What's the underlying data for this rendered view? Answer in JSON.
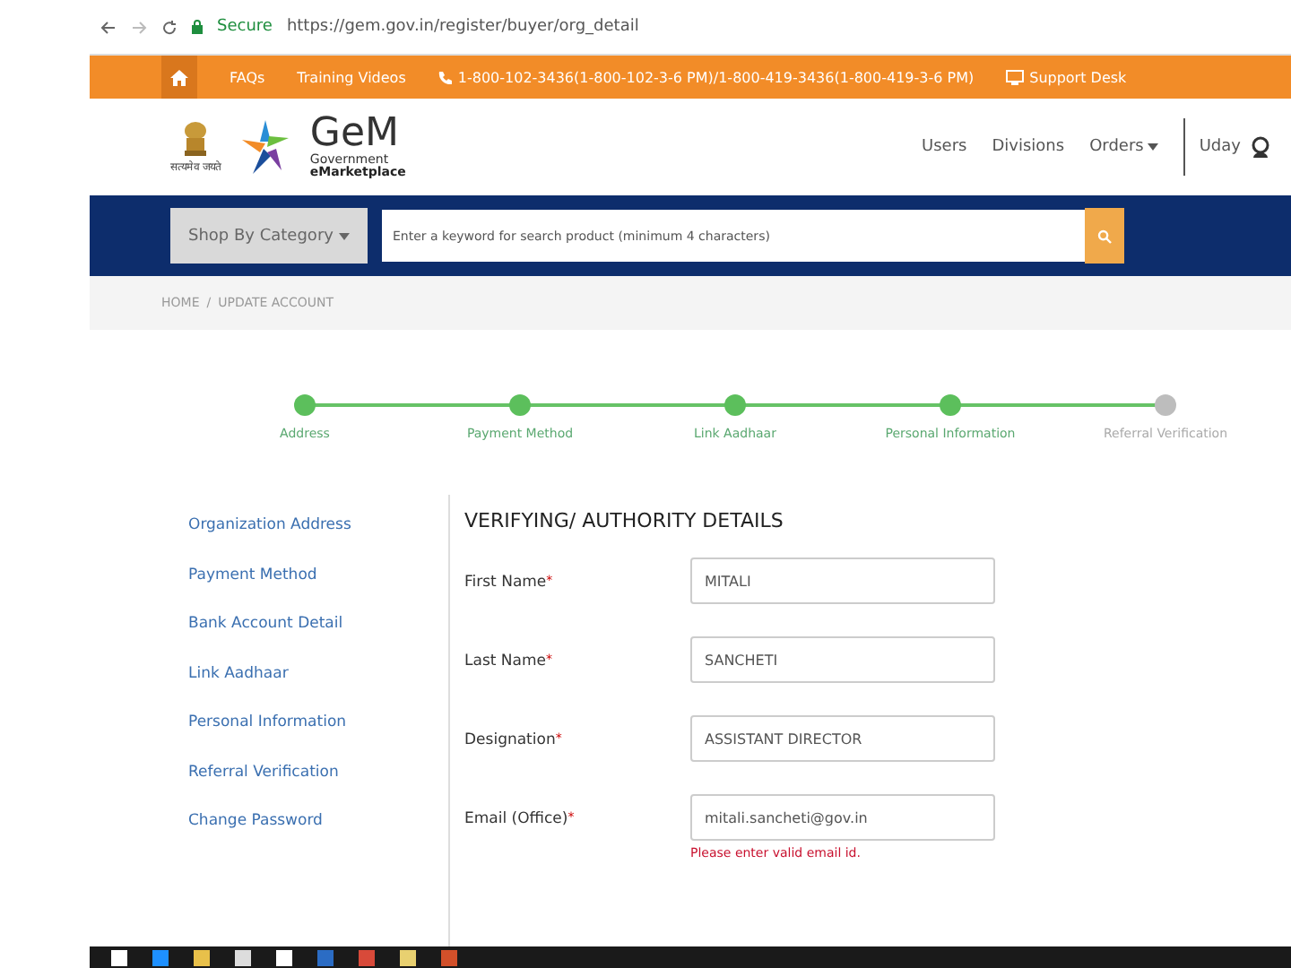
{
  "browser": {
    "secure_label": "Secure",
    "url": "https://gem.gov.in/register/buyer/org_detail"
  },
  "top_bar": {
    "links": [
      {
        "kind": "home"
      },
      {
        "kind": "text",
        "label": "FAQs"
      },
      {
        "kind": "text",
        "label": "Training Videos"
      },
      {
        "kind": "phone",
        "label": "1-800-102-3436(1-800-102-3-6 PM)/1-800-419-3436(1-800-419-3-6 PM)"
      },
      {
        "kind": "desk",
        "label": "Support Desk"
      }
    ]
  },
  "header": {
    "emblem_caption": "सत्यमेव जयते",
    "logo": {
      "name": "GeM",
      "line1": "Government",
      "line2": "eMarketplace"
    },
    "nav": [
      {
        "label": "Users",
        "dropdown": false
      },
      {
        "label": "Divisions",
        "dropdown": false
      },
      {
        "label": "Orders",
        "dropdown": true
      }
    ],
    "user": "Uday"
  },
  "search_bar": {
    "category_button": "Shop By Category",
    "placeholder": "Enter a keyword for search product (minimum 4 characters)"
  },
  "breadcrumb": {
    "items": [
      "HOME",
      "UPDATE ACCOUNT"
    ],
    "separator": "/"
  },
  "steps": [
    {
      "label": "Address",
      "done": true
    },
    {
      "label": "Payment Method",
      "done": true
    },
    {
      "label": "Link Aadhaar",
      "done": true
    },
    {
      "label": "Personal Information",
      "done": true
    },
    {
      "label": "Referral Verification",
      "done": false
    }
  ],
  "sidebar": {
    "items": [
      "Organization Address",
      "Payment Method",
      "Bank Account Detail",
      "Link Aadhaar",
      "Personal Information",
      "Referral Verification",
      "Change Password"
    ]
  },
  "form": {
    "title": "VERIFYING/ AUTHORITY DETAILS",
    "fields": [
      {
        "label": "First Name",
        "required_mark": "*",
        "value": "MITALI"
      },
      {
        "label": "Last Name",
        "required_mark": "*",
        "value": "SANCHETI"
      },
      {
        "label": "Designation",
        "required_mark": "*",
        "value": "ASSISTANT DIRECTOR"
      },
      {
        "label": "Email (Office)",
        "required_mark": "*",
        "value": "mitali.sancheti@gov.in",
        "error": "Please enter valid email id."
      }
    ]
  }
}
